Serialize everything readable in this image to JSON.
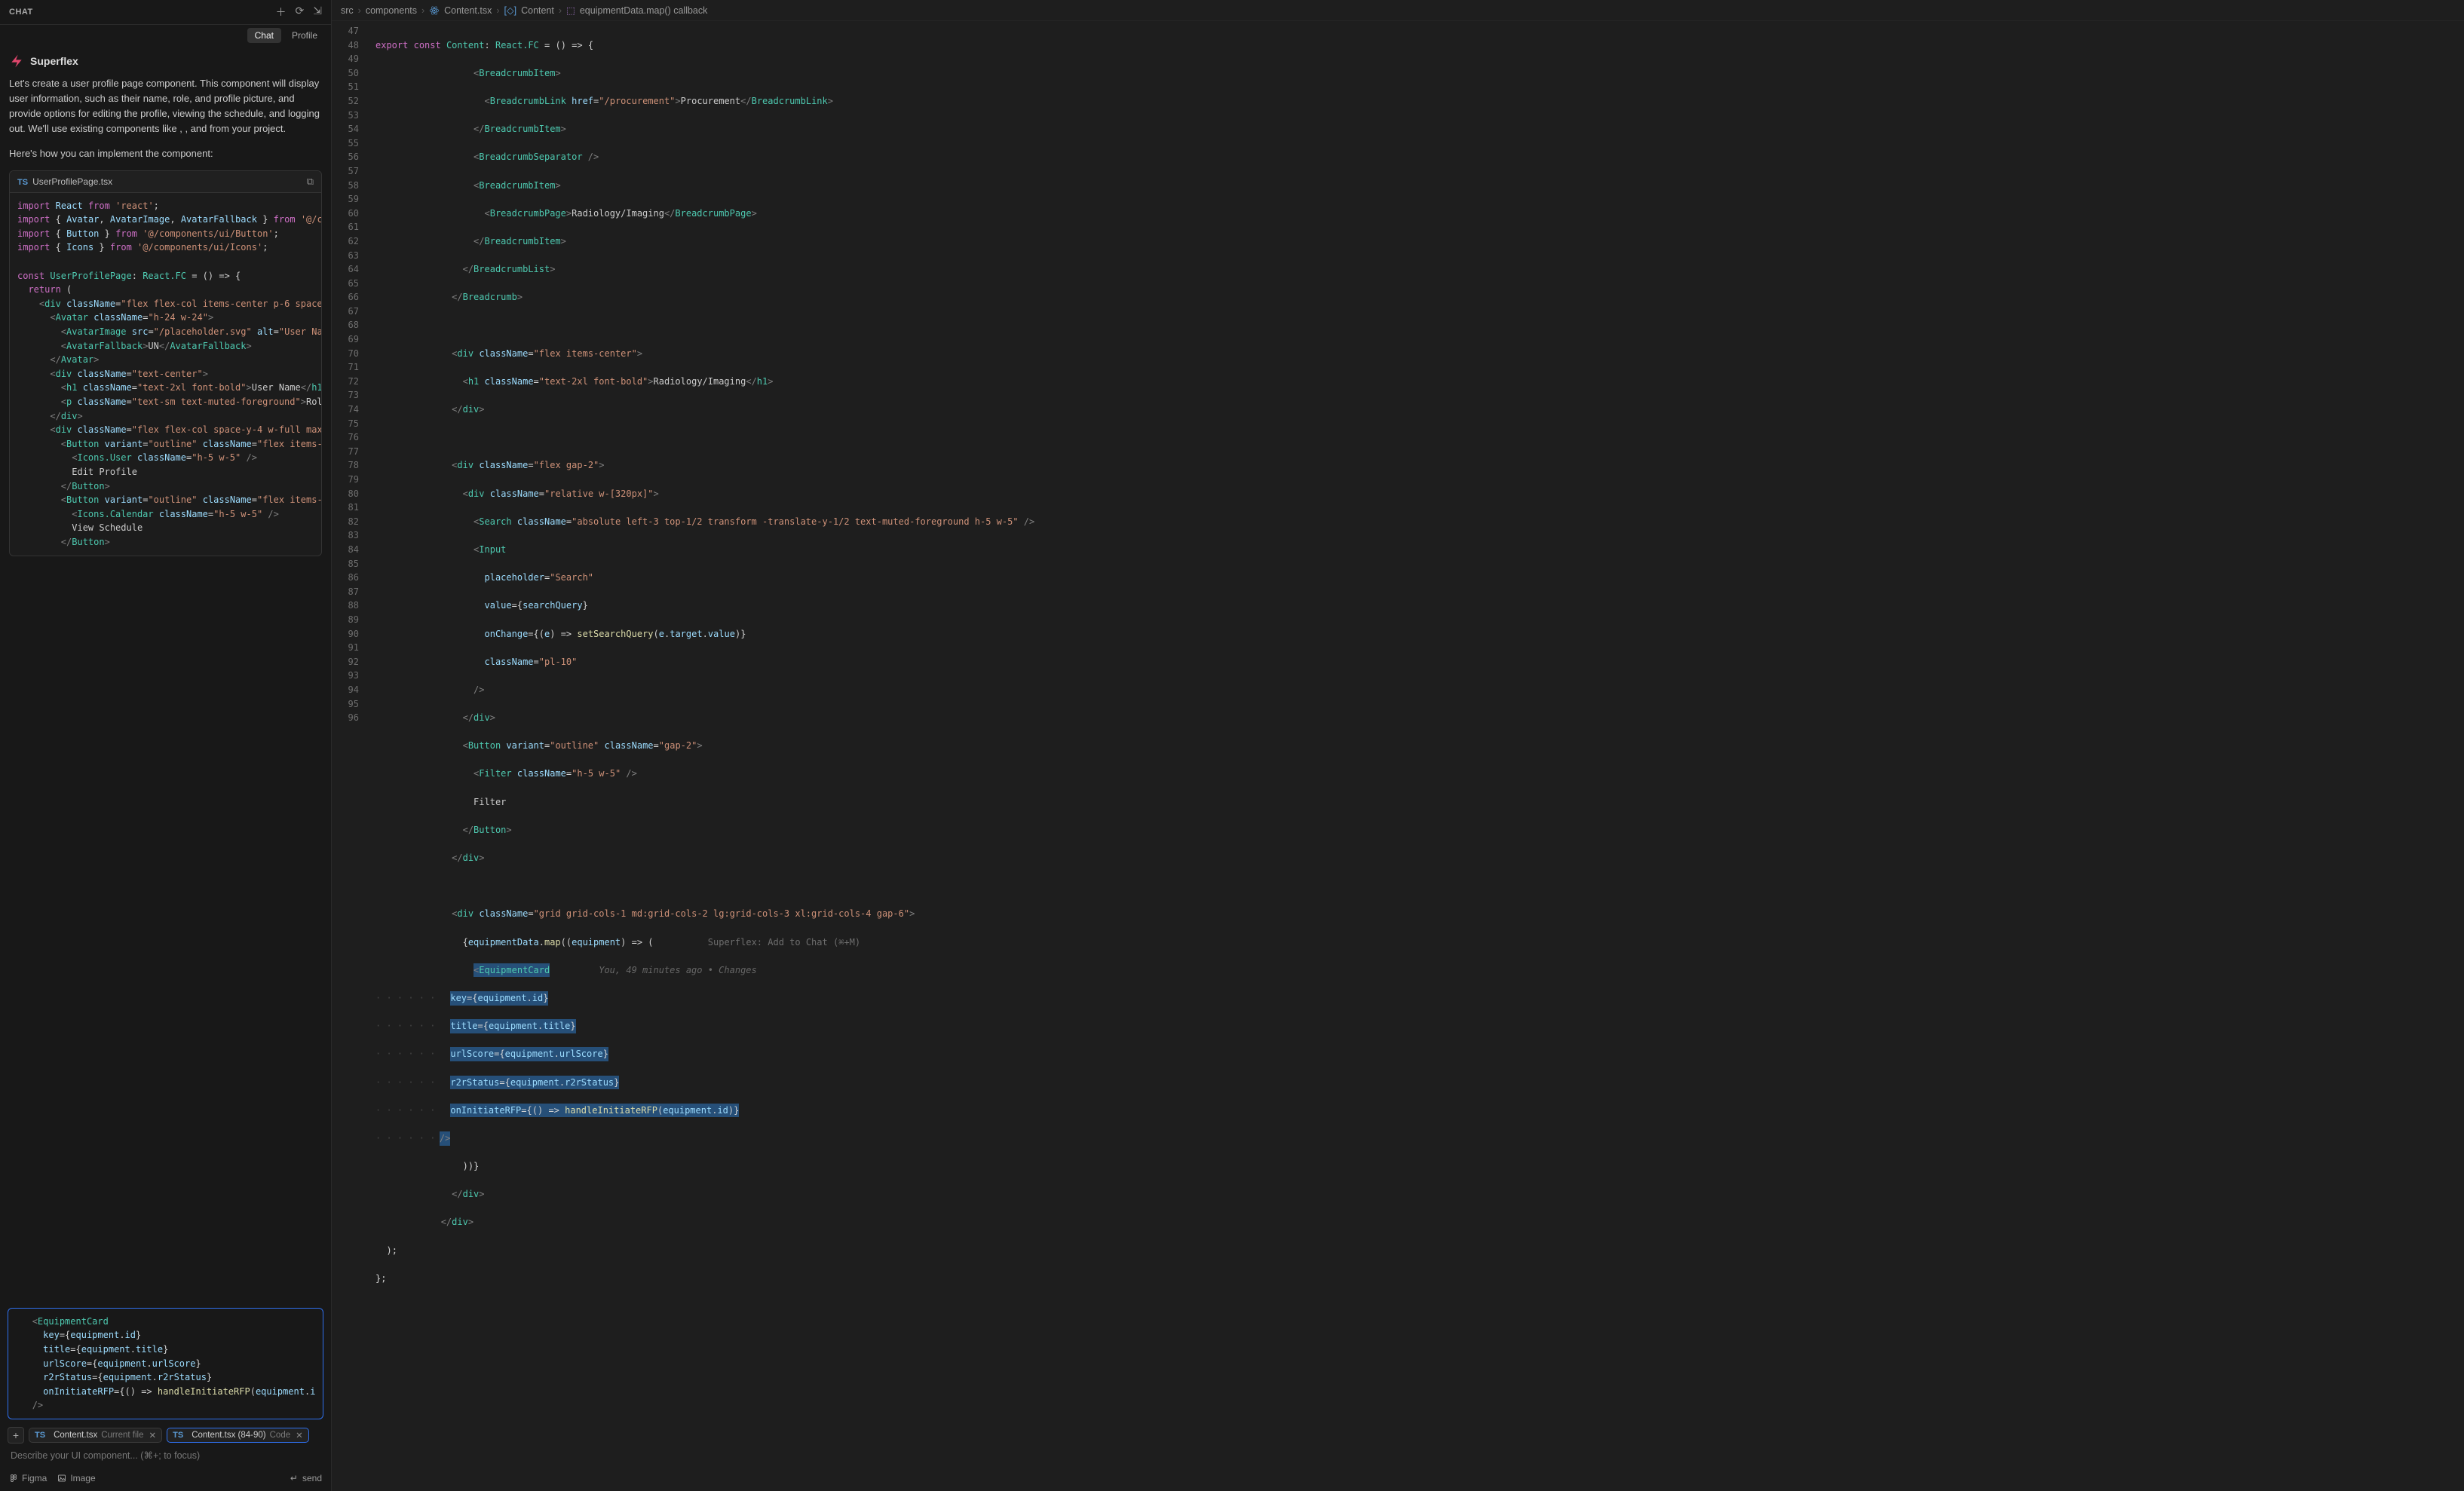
{
  "chat": {
    "title": "CHAT",
    "tabs": {
      "chat": "Chat",
      "profile": "Profile"
    },
    "assistant_name": "Superflex",
    "paragraph1": "Let's create a user profile page component. This component will display user information, such as their name, role, and profile picture, and provide options for editing the profile, viewing the schedule, and logging out. We'll use existing components like      ,      , and        from your project.",
    "paragraph2": "Here's how you can implement the          component:",
    "code_file": "UserProfilePage.tsx",
    "context_add_label": "+",
    "ctx1_file": "Content.tsx",
    "ctx1_sub": "Current file",
    "ctx2_file": "Content.tsx (84-90)",
    "ctx2_sub": "Code",
    "input_placeholder": "Describe your UI component... (⌘+; to focus)",
    "footer_figma": "Figma",
    "footer_image": "Image",
    "footer_send": "send"
  },
  "editor": {
    "breadcrumb": {
      "p1": "src",
      "p2": "components",
      "p3": "Content.tsx",
      "p4": "Content",
      "p5": "equipmentData.map() callback"
    },
    "codelens": "Superflex: Add to Chat (⌘+M)",
    "git_annotation": "You, 49 minutes ago • Changes",
    "line_start": 47,
    "line_end": 96
  }
}
